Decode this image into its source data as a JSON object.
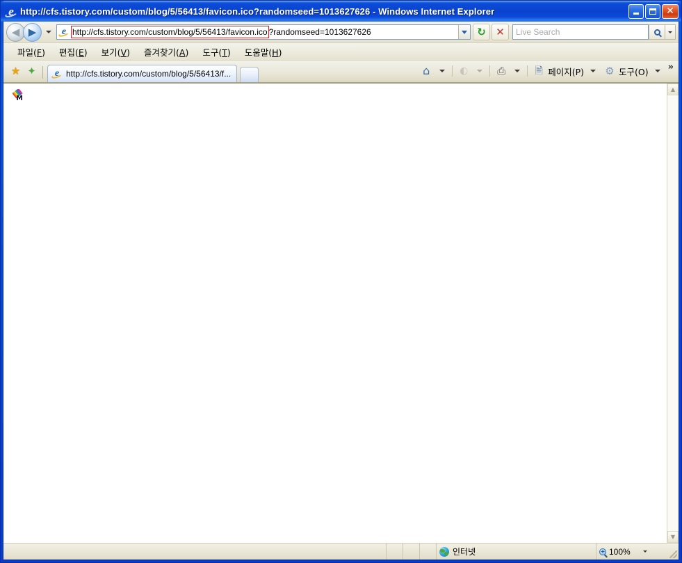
{
  "window": {
    "title": "http://cfs.tistory.com/custom/blog/5/56413/favicon.ico?randomseed=1013627626 - Windows Internet Explorer",
    "app_icon": "internet-explorer-icon",
    "caption": {
      "minimize_label": "",
      "maximize_label": "",
      "close_label": "✕"
    }
  },
  "toolbar": {
    "back_glyph": "◀",
    "forward_glyph": "▶",
    "recent_pages_glyph": "▼",
    "address": {
      "favicon": "internet-explorer-icon",
      "url_base": "http://cfs.tistory.com/custom/blog/5/56413/favicon.ico",
      "url_query": "?randomseed=1013627626",
      "full_url": "http://cfs.tistory.com/custom/blog/5/56413/favicon.ico?randomseed=1013627626",
      "highlight_color": "#e01b1b"
    },
    "refresh_glyph": "↻",
    "stop_glyph": "✕",
    "search": {
      "placeholder": "Live Search",
      "value": "",
      "go_icon": "magnifier-icon",
      "dropdown_glyph": "▼"
    }
  },
  "menubar": {
    "items": [
      {
        "label": "파일(",
        "accel": "F",
        "tail": ")"
      },
      {
        "label": "편집(",
        "accel": "E",
        "tail": ")"
      },
      {
        "label": "보기(",
        "accel": "V",
        "tail": ")"
      },
      {
        "label": "즐겨찾기(",
        "accel": "A",
        "tail": ")"
      },
      {
        "label": "도구(",
        "accel": "T",
        "tail": ")"
      },
      {
        "label": "도움말(",
        "accel": "H",
        "tail": ")"
      }
    ]
  },
  "tabbar": {
    "favorites_center_icon": "star-icon",
    "add_favorite_icon": "star-plus-icon",
    "tabs": [
      {
        "title": "http://cfs.tistory.com/custom/blog/5/56413/f...",
        "favicon": "internet-explorer-icon",
        "active": true
      }
    ],
    "new_tab_label": "",
    "commands": [
      {
        "name": "home",
        "icon": "home-icon",
        "glyph": "⌂",
        "label": "",
        "has_dropdown": true,
        "disabled": false
      },
      {
        "name": "feeds",
        "icon": "rss-icon",
        "glyph": "◖",
        "label": "",
        "has_dropdown": true,
        "disabled": true
      },
      {
        "name": "print",
        "icon": "printer-icon",
        "glyph": "⎙",
        "label": "",
        "has_dropdown": true,
        "disabled": false
      },
      {
        "name": "page",
        "icon": "page-icon",
        "glyph": "✎",
        "label": "페이지(P)",
        "has_dropdown": true,
        "disabled": false
      },
      {
        "name": "tools",
        "icon": "gear-icon",
        "glyph": "⚙",
        "label": "도구(O)",
        "has_dropdown": true,
        "disabled": false
      }
    ],
    "overflow_glyph": "»"
  },
  "content": {
    "favicon_alt": "rainbow-m-favicon",
    "background_color": "#ffffff"
  },
  "scrollbar": {
    "up_glyph": "▲",
    "down_glyph": "▼"
  },
  "statusbar": {
    "message": "",
    "zone_icon": "globe-icon",
    "zone_label": "인터넷",
    "zoom_icon": "magnifier-plus-icon",
    "zoom_label": "100%",
    "zoom_dropdown_glyph": "▼"
  }
}
